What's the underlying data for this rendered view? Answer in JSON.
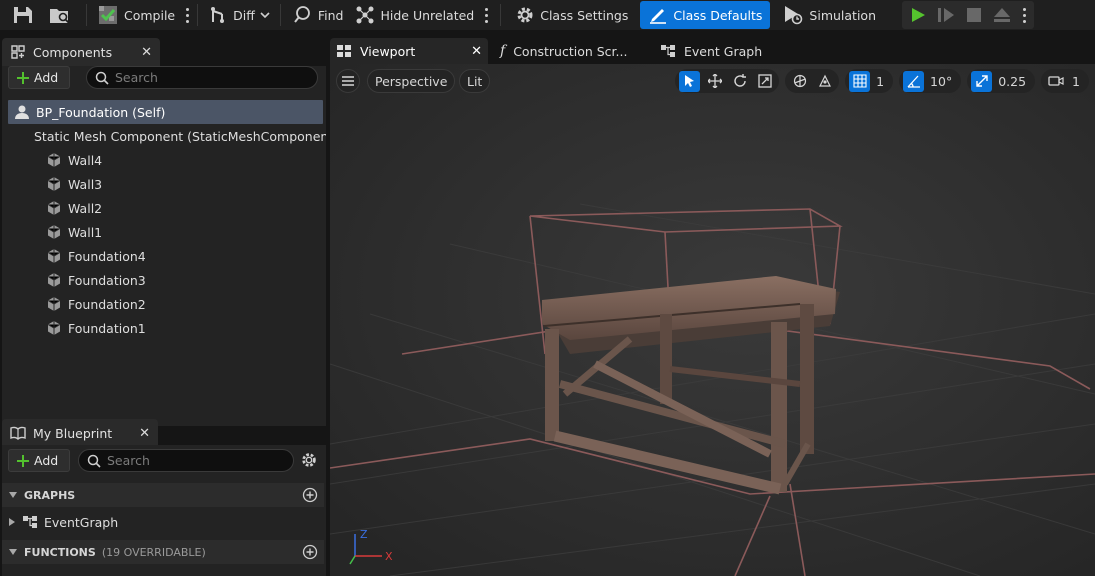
{
  "toolbar": {
    "compile_label": "Compile",
    "diff_label": "Diff",
    "find_label": "Find",
    "hide_unrelated_label": "Hide Unrelated",
    "class_settings_label": "Class Settings",
    "class_defaults_label": "Class Defaults",
    "simulation_label": "Simulation",
    "accent_color": "#0a73d8"
  },
  "components_panel": {
    "title": "Components",
    "add_label": "Add",
    "search_placeholder": "Search",
    "root_label": "BP_Foundation (Self)",
    "mesh_component_label": "Static Mesh Component (StaticMeshComponent)",
    "items": [
      "Wall4",
      "Wall3",
      "Wall2",
      "Wall1",
      "Foundation4",
      "Foundation3",
      "Foundation2",
      "Foundation1"
    ]
  },
  "blueprint_panel": {
    "title": "My Blueprint",
    "add_label": "Add",
    "search_placeholder": "Search",
    "graphs_header": "GRAPHS",
    "graph_item": "EventGraph",
    "functions_header": "FUNCTIONS",
    "functions_sub": "(19 OVERRIDABLE)"
  },
  "editor_tabs": {
    "viewport": "Viewport",
    "construction": "Construction Scr...",
    "event_graph": "Event Graph"
  },
  "viewport": {
    "perspective_label": "Perspective",
    "lit_label": "Lit",
    "grid_value": "1",
    "angle_value": "10°",
    "scale_value": "0.25",
    "camera_value": "1",
    "axis_z": "Z",
    "axis_x": "X"
  }
}
